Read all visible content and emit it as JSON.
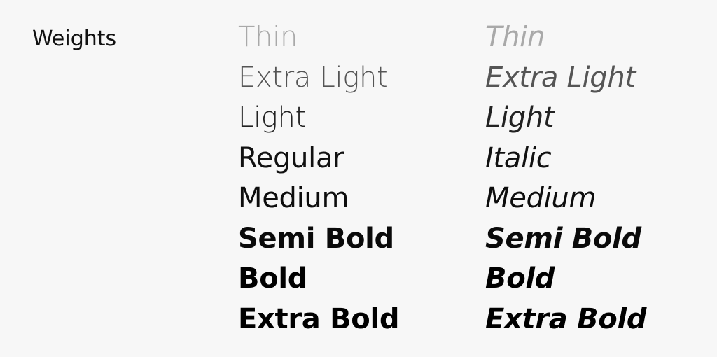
{
  "section_label": "Weights",
  "upright": {
    "thin": "Thin",
    "extra_light": "Extra Light",
    "light": "Light",
    "regular": "Regular",
    "medium": "Medium",
    "semi_bold": "Semi Bold",
    "bold": "Bold",
    "extra_bold": "Extra Bold"
  },
  "italic": {
    "thin": "Thin",
    "extra_light": "Extra Light",
    "light": "Light",
    "regular": "Italic",
    "medium": "Medium",
    "semi_bold": "Semi Bold",
    "bold": "Bold",
    "extra_bold": "Extra Bold"
  }
}
